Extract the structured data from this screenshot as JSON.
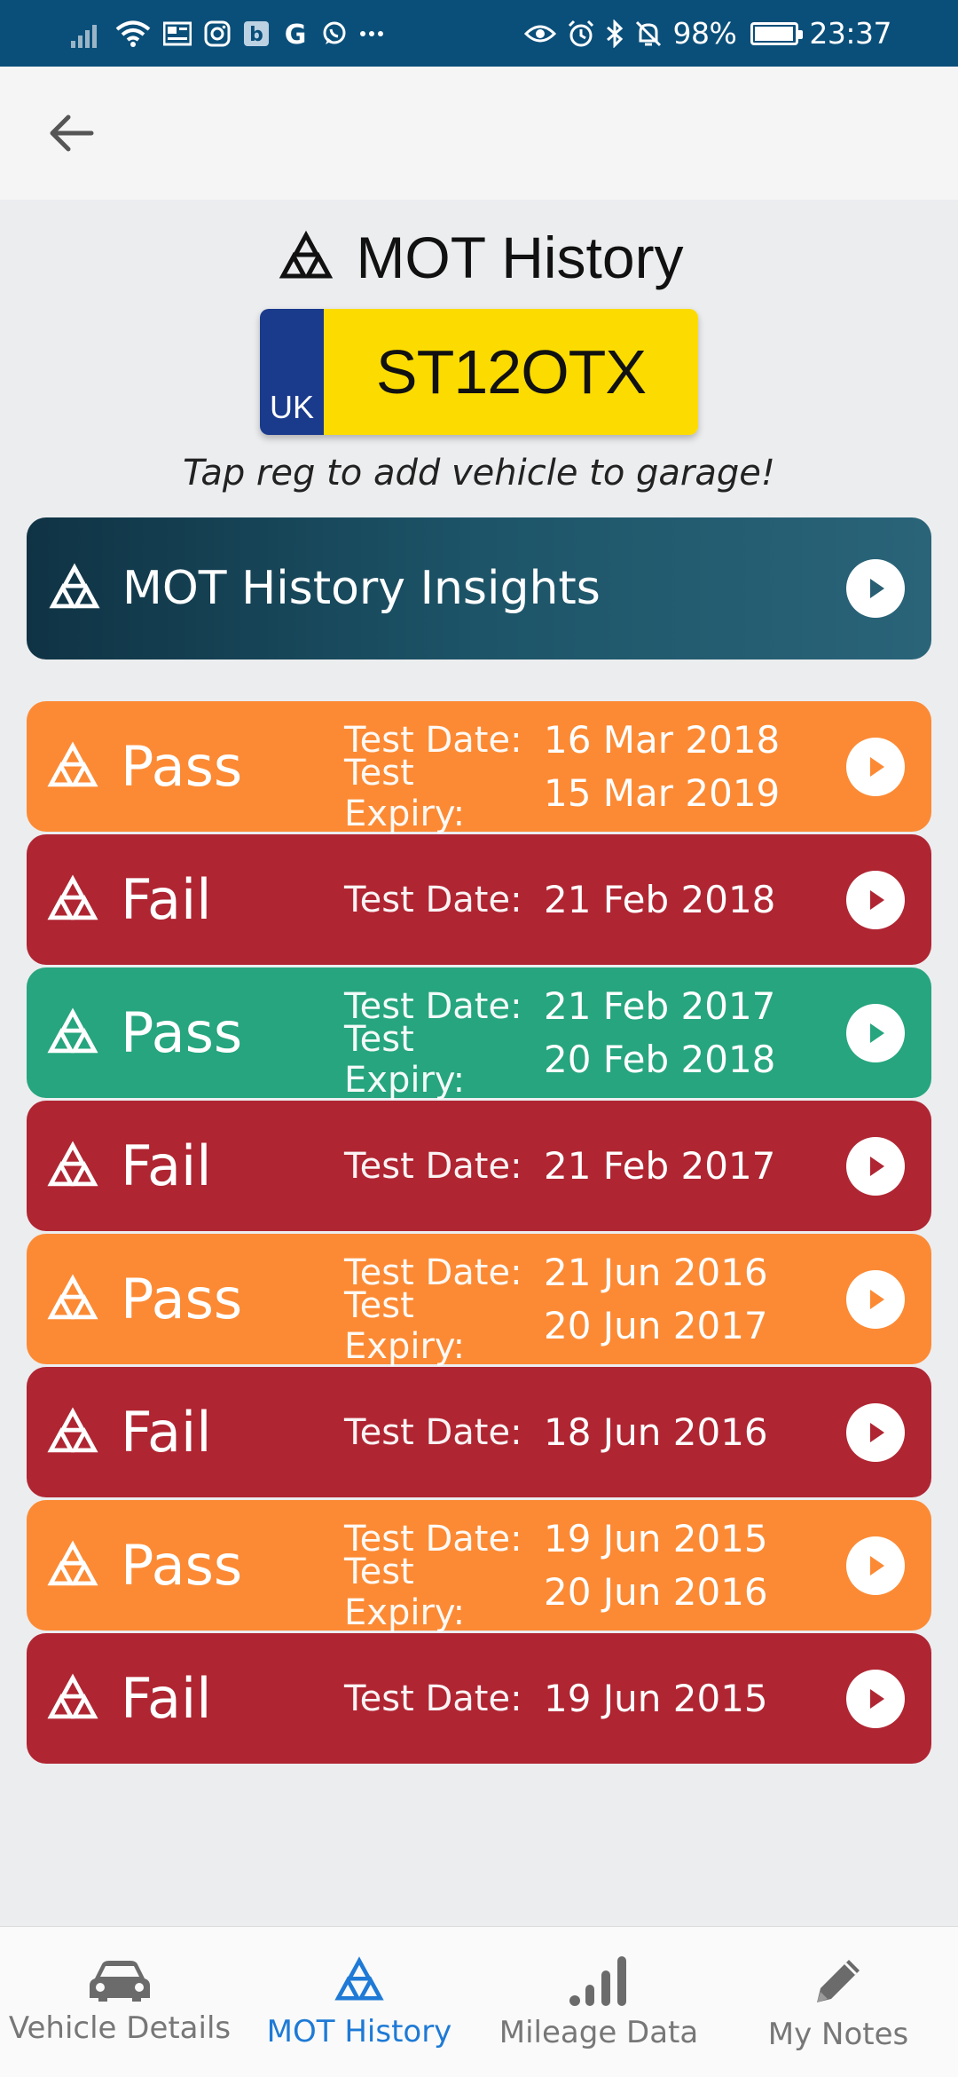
{
  "status_bar": {
    "battery": "98%",
    "time": "23:37"
  },
  "page": {
    "title": "MOT History",
    "plate": {
      "country": "UK",
      "reg": "ST12OTX"
    },
    "hint": "Tap reg to add vehicle to garage!",
    "insights_label": "MOT History Insights"
  },
  "colors": {
    "pass_orange": "#fc8a34",
    "pass_green": "#26a57e",
    "fail_red": "#b02532",
    "active_nav": "#1e7ad6"
  },
  "labels": {
    "test_date": "Test Date:",
    "test_expiry": "Test Expiry:"
  },
  "mot_records": [
    {
      "status": "Pass",
      "test_date": "16 Mar 2018",
      "expiry": "15 Mar 2019",
      "color": "#fc8a34"
    },
    {
      "status": "Fail",
      "test_date": "21 Feb 2018",
      "expiry": null,
      "color": "#b02532"
    },
    {
      "status": "Pass",
      "test_date": "21 Feb 2017",
      "expiry": "20 Feb 2018",
      "color": "#26a57e"
    },
    {
      "status": "Fail",
      "test_date": "21 Feb 2017",
      "expiry": null,
      "color": "#b02532"
    },
    {
      "status": "Pass",
      "test_date": "21 Jun 2016",
      "expiry": "20 Jun 2017",
      "color": "#fc8a34"
    },
    {
      "status": "Fail",
      "test_date": "18 Jun 2016",
      "expiry": null,
      "color": "#b02532"
    },
    {
      "status": "Pass",
      "test_date": "19 Jun 2015",
      "expiry": "20 Jun 2016",
      "color": "#fc8a34"
    },
    {
      "status": "Fail",
      "test_date": "19 Jun 2015",
      "expiry": null,
      "color": "#b02532"
    }
  ],
  "bottom_nav": [
    {
      "label": "Vehicle Details",
      "icon": "car-icon",
      "active": false
    },
    {
      "label": "MOT History",
      "icon": "mot-icon",
      "active": true
    },
    {
      "label": "Mileage Data",
      "icon": "bar-chart-icon",
      "active": false
    },
    {
      "label": "My Notes",
      "icon": "pencil-icon",
      "active": false
    }
  ]
}
